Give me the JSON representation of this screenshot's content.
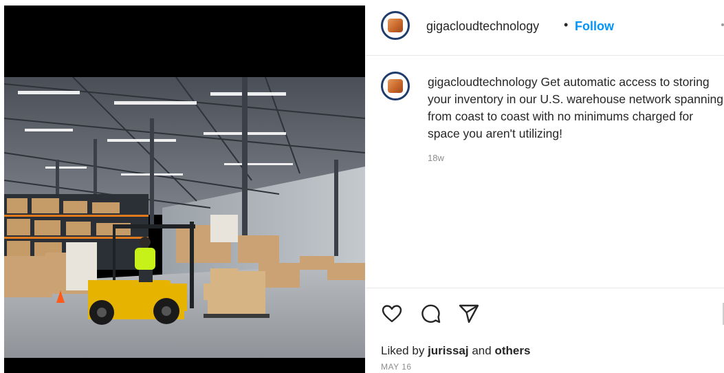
{
  "post": {
    "username": "gigacloudtechnology",
    "separator": "•",
    "follow_label": "Follow",
    "caption_user": "gigacloudtechnology",
    "caption_text": "Get automatic access to storing your inventory in our U.S. warehouse network spanning from coast to coast with no minimums charged for space you aren't utilizing!",
    "time_ago": "18w",
    "likes_prefix": "Liked by",
    "likes_user": "jurissaj",
    "likes_and": "and",
    "likes_others": "others",
    "date": "MAY 16"
  },
  "icons": {
    "avatar": "box-logo-icon",
    "like": "heart-icon",
    "comment": "comment-icon",
    "share": "send-icon",
    "more": "more-options-icon"
  },
  "colors": {
    "follow": "#0095f6",
    "avatar_ring": "#1f3d6b",
    "forklift": "#e6b400"
  }
}
